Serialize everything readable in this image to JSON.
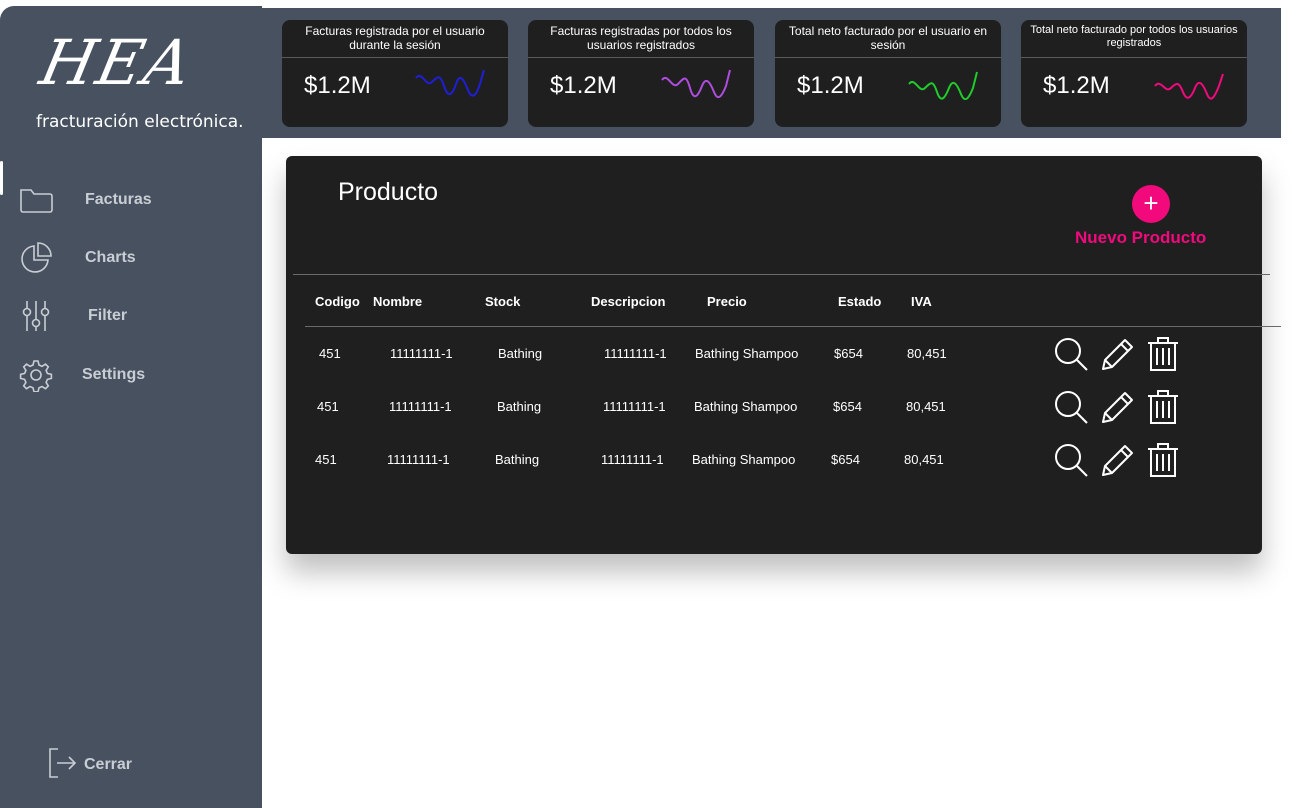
{
  "brand": {
    "logo_text": "HEA",
    "subtitle": "fracturación electrónica."
  },
  "nav": [
    {
      "label": "Facturas",
      "icon": "folder-icon"
    },
    {
      "label": "Charts",
      "icon": "pie-chart-icon"
    },
    {
      "label": "Filter",
      "icon": "sliders-icon"
    },
    {
      "label": "Settings",
      "icon": "gear-icon"
    }
  ],
  "logout": {
    "label": "Cerrar",
    "icon": "logout-icon"
  },
  "stats": [
    {
      "title": "Facturas registrada por el usuario durante la sesión",
      "value": "$1.2M",
      "color": "#1f1fd6"
    },
    {
      "title": "Facturas registradas por todos los usuarios registrados",
      "value": "$1.2M",
      "color": "#b04de0"
    },
    {
      "title": "Total neto facturado por el usuario en sesión",
      "value": "$1.2M",
      "color": "#1fcc2a"
    },
    {
      "title": "Total neto facturado por todos los usuarios registrados",
      "value": "$1.2M",
      "color": "#f20a7d"
    }
  ],
  "panel": {
    "title": "Producto",
    "new_button_icon": "+",
    "new_button_label": "Nuevo Producto",
    "accent": "#f20a7d"
  },
  "table": {
    "headers": [
      "Codigo",
      "Nombre",
      "Stock",
      "Descripcion",
      "Precio",
      "Estado",
      "IVA"
    ],
    "rows": [
      [
        "451",
        "11111111-1",
        "Bathing",
        "11111111-1",
        "Bathing Shampoo",
        "$654",
        "80,451"
      ],
      [
        "451",
        "11111111-1",
        "Bathing",
        "11111111-1",
        "Bathing Shampoo",
        "$654",
        "80,451"
      ],
      [
        "451",
        "11111111-1",
        "Bathing",
        "11111111-1",
        "Bathing Shampoo",
        "$654",
        "80,451"
      ]
    ],
    "actions": [
      "search-icon",
      "edit-icon",
      "trash-icon"
    ]
  }
}
